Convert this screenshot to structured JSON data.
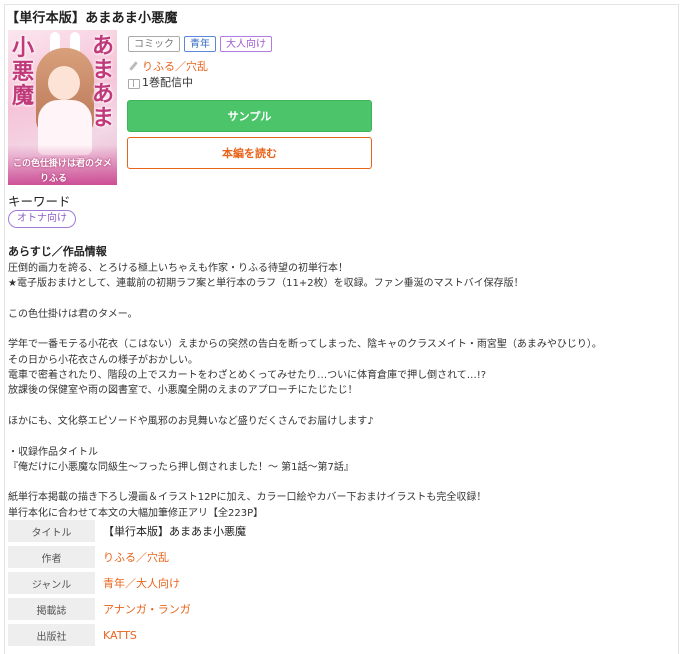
{
  "title": "【単行本版】あまあま小悪魔",
  "tags": {
    "comic": "コミック",
    "seinen": "青年",
    "adult": "大人向け"
  },
  "author": "りふる／穴乱",
  "volumes": "1巻配信中",
  "buttons": {
    "sample": "サンプル",
    "read": "本編を読む"
  },
  "keywords": {
    "heading": "キーワード",
    "items": [
      "オトナ向け"
    ]
  },
  "synopsis": {
    "heading": "あらすじ／作品情報",
    "lines": [
      "圧倒的画力を誇る、とろける極上いちゃえも作家・りふる待望の初単行本！",
      "★電子版おまけとして、連載前の初期ラフ案と単行本のラフ（11+2枚）を収録。ファン垂涎のマストバイ保存版！",
      "",
      "この色仕掛けは君のタメー。",
      "",
      "学年で一番モテる小花衣（こはない）えまからの突然の告白を断ってしまった、陰キャのクラスメイト・雨宮聖（あまみやひじり）。",
      "その日から小花衣さんの様子がおかしい。",
      "電車で密着されたり、階段の上でスカートをわざとめくってみせたり…ついに体育倉庫で押し倒されて…!?",
      "放課後の保健室や雨の図書室で、小悪魔全開のえまのアプローチにたじたじ！",
      "",
      "ほかにも、文化祭エピソードや風邪のお見舞いなど盛りだくさんでお届けします♪",
      "",
      "・収録作品タイトル",
      "『俺だけに小悪魔な同級生～フったら押し倒されました！～ 第1話～第7話』",
      "",
      "紙単行本掲載の描き下ろし漫画＆イラスト12Pに加え、カラー口絵やカバー下おまけイラストも完全収録！",
      "単行本化に合わせて本文の大幅加筆修正アリ【全223P】"
    ]
  },
  "info": [
    {
      "label": "タイトル",
      "value": "【単行本版】あまあま小悪魔",
      "link": false
    },
    {
      "label": "作者",
      "value": "りふる／穴乱",
      "link": true
    },
    {
      "label": "ジャンル",
      "value": "青年／大人向け",
      "link": true
    },
    {
      "label": "掲載誌",
      "value": "アナンガ・ランガ",
      "link": true
    },
    {
      "label": "出版社",
      "value": "KATTS",
      "link": true
    }
  ],
  "cover": {
    "title_top": "あまあま",
    "title_side": "小悪魔",
    "subtitle": "この色仕掛けは君のタメ",
    "author": "りふる"
  }
}
